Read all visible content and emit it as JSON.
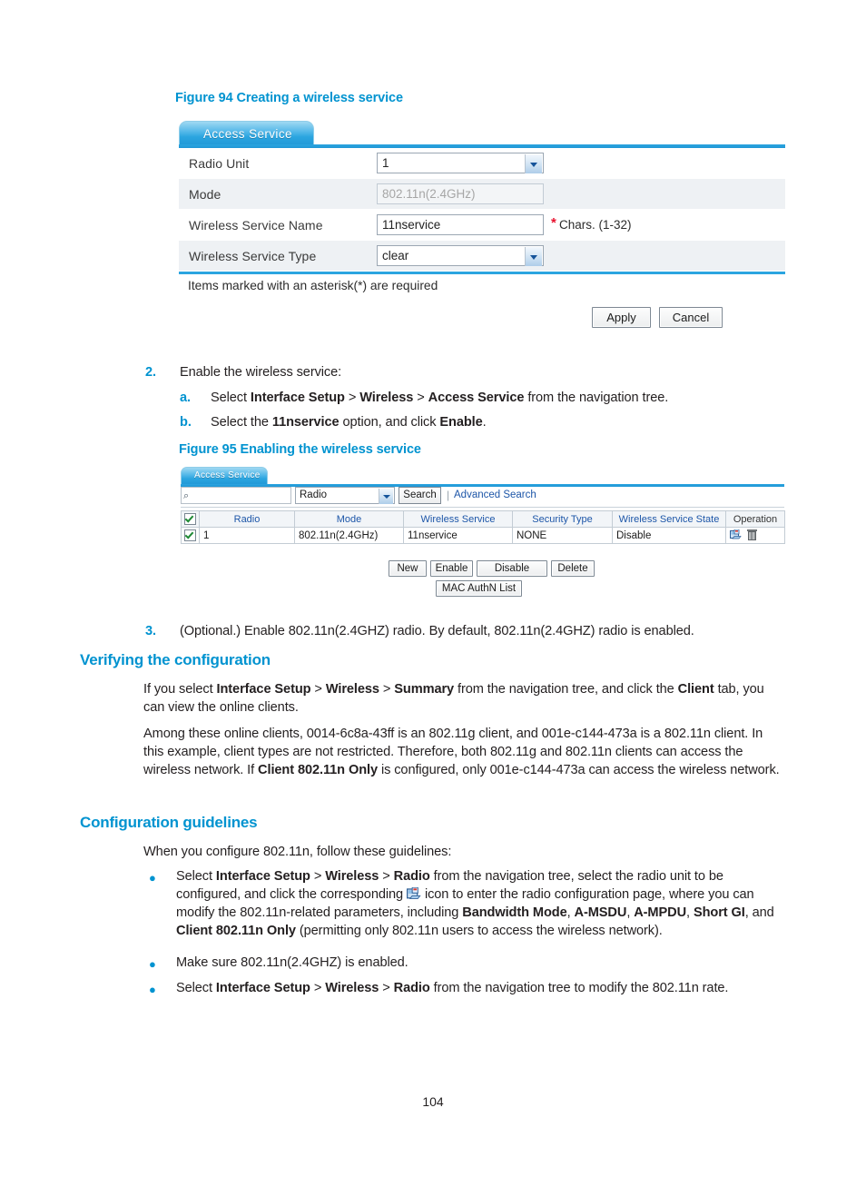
{
  "document": {
    "page_number": "104"
  },
  "figure94": {
    "caption": "Figure 94 Creating a wireless service",
    "tab_label": "Access Service",
    "rows": [
      {
        "label": "Radio Unit",
        "value": "1",
        "control": "select"
      },
      {
        "label": "Mode",
        "value": "802.11n(2.4GHz)",
        "control": "text-disabled"
      },
      {
        "label": "Wireless Service Name",
        "value": "11nservice",
        "control": "text",
        "star": "*",
        "hint": "Chars. (1-32)"
      },
      {
        "label": "Wireless Service Type",
        "value": "clear",
        "control": "select"
      }
    ],
    "note": "Items marked with an asterisk(*) are required",
    "apply_label": "Apply",
    "cancel_label": "Cancel"
  },
  "step2": {
    "number": "2.",
    "text": "Enable the wireless service:",
    "sub_a_marker": "a.",
    "sub_a_pre": "Select ",
    "sub_a_b1": "Interface Setup",
    "sub_a_sep1": " > ",
    "sub_a_b2": "Wireless",
    "sub_a_sep2": " > ",
    "sub_a_b3": "Access Service",
    "sub_a_post": " from the navigation tree.",
    "sub_b_marker": "b.",
    "sub_b_pre": "Select the ",
    "sub_b_b1": "11nservice",
    "sub_b_mid": " option, and click ",
    "sub_b_b2": "Enable",
    "sub_b_post": "."
  },
  "figure95": {
    "caption": "Figure 95 Enabling the wireless service",
    "tab_label": "Access Service",
    "search": {
      "input_value": "",
      "input_placeholder": "",
      "select_value": "Radio",
      "button_label": "Search",
      "separator": "|",
      "advanced_label": "Advanced Search"
    },
    "table": {
      "headers": [
        "",
        "Radio",
        "Mode",
        "Wireless Service",
        "Security Type",
        "Wireless Service State",
        "Operation"
      ],
      "rows": [
        {
          "radio": "1",
          "mode": "802.11n(2.4GHz)",
          "wireless_service": "11nservice",
          "security_type": "NONE",
          "wireless_service_state": "Disable"
        }
      ]
    },
    "buttons": {
      "new": "New",
      "enable": "Enable",
      "disable": "Disable",
      "delete": "Delete",
      "mac_authn_list": "MAC AuthN List"
    }
  },
  "step3": {
    "number": "3.",
    "text": "(Optional.) Enable 802.11n(2.4GHZ) radio. By default, 802.11n(2.4GHZ) radio is enabled."
  },
  "verifying": {
    "heading": "Verifying the configuration",
    "p1_pre": "If you select ",
    "p1_b1": "Interface Setup",
    "p1_sep1": " > ",
    "p1_b2": "Wireless",
    "p1_sep2": " > ",
    "p1_b3": "Summary",
    "p1_mid": " from the navigation tree, and click the ",
    "p1_b4": "Client",
    "p1_post": " tab, you can view the online clients.",
    "p2_pre": "Among these online clients, 0014-6c8a-43ff is an 802.11g client, and 001e-c144-473a is a 802.11n client. In this example, client types are not restricted. Therefore, both 802.11g and 802.11n clients can access the wireless network. If ",
    "p2_b1": "Client 802.11n Only",
    "p2_post": " is configured, only 001e-c144-473a can access the wireless network."
  },
  "guidelines": {
    "heading": "Configuration guidelines",
    "intro": "When you configure 802.11n, follow these guidelines:",
    "b1_pre": "Select ",
    "b1_b1": "Interface Setup",
    "b1_sep1": " > ",
    "b1_b2": "Wireless",
    "b1_sep2": " > ",
    "b1_b3": "Radio",
    "b1_mid1": " from the navigation tree, select the radio unit to be configured, and click the corresponding ",
    "b1_mid2": " icon to enter the radio configuration page, where you can modify the 802.11n-related parameters, including ",
    "b1_b4": "Bandwidth Mode",
    "b1_c1": ", ",
    "b1_b5": "A-MSDU",
    "b1_c2": ", ",
    "b1_b6": "A-MPDU",
    "b1_c3": ", ",
    "b1_b7": "Short GI",
    "b1_c4": ", and ",
    "b1_b8": "Client 802.11n Only",
    "b1_post": " (permitting only 802.11n users to access the wireless network).",
    "b2": "Make sure 802.11n(2.4GHZ) is enabled.",
    "b3_pre": "Select ",
    "b3_b1": "Interface Setup",
    "b3_sep1": " > ",
    "b3_b2": "Wireless",
    "b3_sep2": " > ",
    "b3_b3": "Radio",
    "b3_post": " from the navigation tree to modify the 802.11n rate."
  },
  "colors": {
    "accent_blue": "#0093d0",
    "link_blue": "#1d56a8",
    "text": "#231f20",
    "required_red": "#e8112d"
  }
}
